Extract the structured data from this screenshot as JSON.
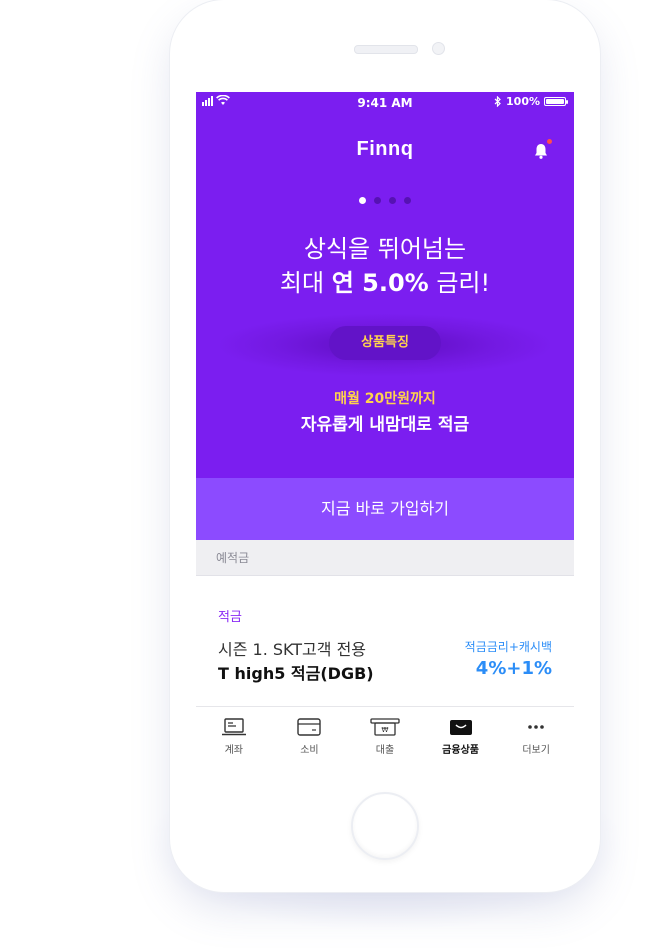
{
  "status_bar": {
    "time": "9:41 AM",
    "battery": "100%"
  },
  "app": {
    "logo": "Finnq"
  },
  "carousel": {
    "dots": 4,
    "active_index": 0
  },
  "hero": {
    "line1": "상식을 뛰어넘는",
    "line2_prefix": "최대 ",
    "line2_bold": "연 5.0%",
    "line2_suffix": " 금리!",
    "feature_button": "상품특징",
    "sub_highlight": "매월 20만원까지",
    "sub_main": "자유롭게 내맘대로 적금"
  },
  "cta": {
    "label": "지금 바로 가입하기"
  },
  "section": {
    "title": "예적금"
  },
  "product": {
    "category": "적금",
    "name_line1": "시즌 1. SKT고객 전용",
    "name_line2": "T high5 적금(DGB)",
    "rate_label": "적금금리+캐시백",
    "rate_value": "4%+1%"
  },
  "tabs": [
    {
      "label": "계좌",
      "icon": "laptop-icon",
      "active": false
    },
    {
      "label": "소비",
      "icon": "card-icon",
      "active": false
    },
    {
      "label": "대출",
      "icon": "loan-icon",
      "active": false
    },
    {
      "label": "금융상품",
      "icon": "bag-icon",
      "active": true
    },
    {
      "label": "더보기",
      "icon": "more-icon",
      "active": false
    }
  ],
  "colors": {
    "hero_bg": "#7b1ef0",
    "cta_bg": "#8c4bff",
    "highlight": "#ffd34d",
    "rate": "#2b8df7",
    "category": "#8b2cf5"
  }
}
